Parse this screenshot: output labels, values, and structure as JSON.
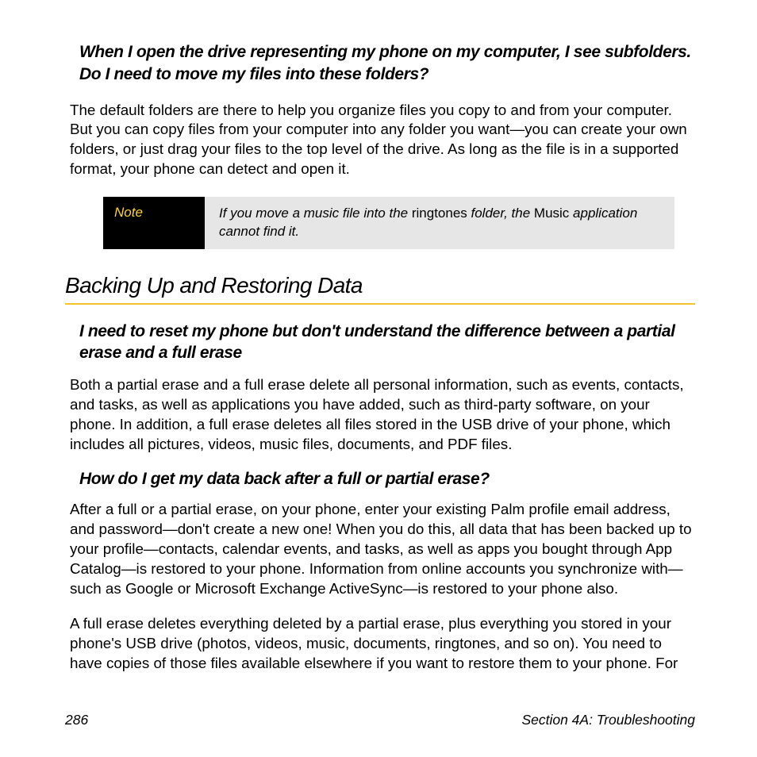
{
  "q1": "When I open the drive representing my phone on my computer, I see subfolders. Do I need to move my files into these folders?",
  "p1": "The default folders are there to help you organize files you copy to and from your computer. But you can copy files from your computer into any folder you want—you can create your own folders, or just drag your files to the top level of the drive. As long as the file is in a supported format, your phone can detect and open it.",
  "note_label": "Note",
  "note_t1": "If you move a music file into the ",
  "note_b1": "ringtones",
  "note_t2": " folder, the ",
  "note_b2": "Music",
  "note_t3": " application cannot find it.",
  "section": "Backing Up and Restoring Data",
  "q2": "I need to reset my phone but don't understand the difference between a partial erase and a full erase",
  "p2": "Both a partial erase and a full erase delete all personal information, such as events, contacts, and tasks, as well as applications you have added, such as third-party software, on your phone. In addition, a full erase deletes all files stored in the USB drive of your phone, which includes all pictures, videos, music files, documents, and PDF files.",
  "q3": "How do I get my data back after a full or partial erase?",
  "p3": "After a full or a partial erase, on your phone, enter your existing Palm profile email address, and password—don't create a new one! When you do this, all data that has been backed up to your profile—contacts, calendar events, and tasks, as well as apps you bought through App Catalog—is restored to your phone. Information from online accounts you synchronize with—such as Google or Microsoft Exchange ActiveSync—is restored to your phone also.",
  "p4": "A full erase deletes everything deleted by a partial erase, plus everything you stored in your phone's USB drive (photos, videos, music, documents, ringtones, and so on). You need to have copies of those files available elsewhere if you want to restore them to your phone. For",
  "footer_page": "286",
  "footer_section": "Section 4A: Troubleshooting"
}
